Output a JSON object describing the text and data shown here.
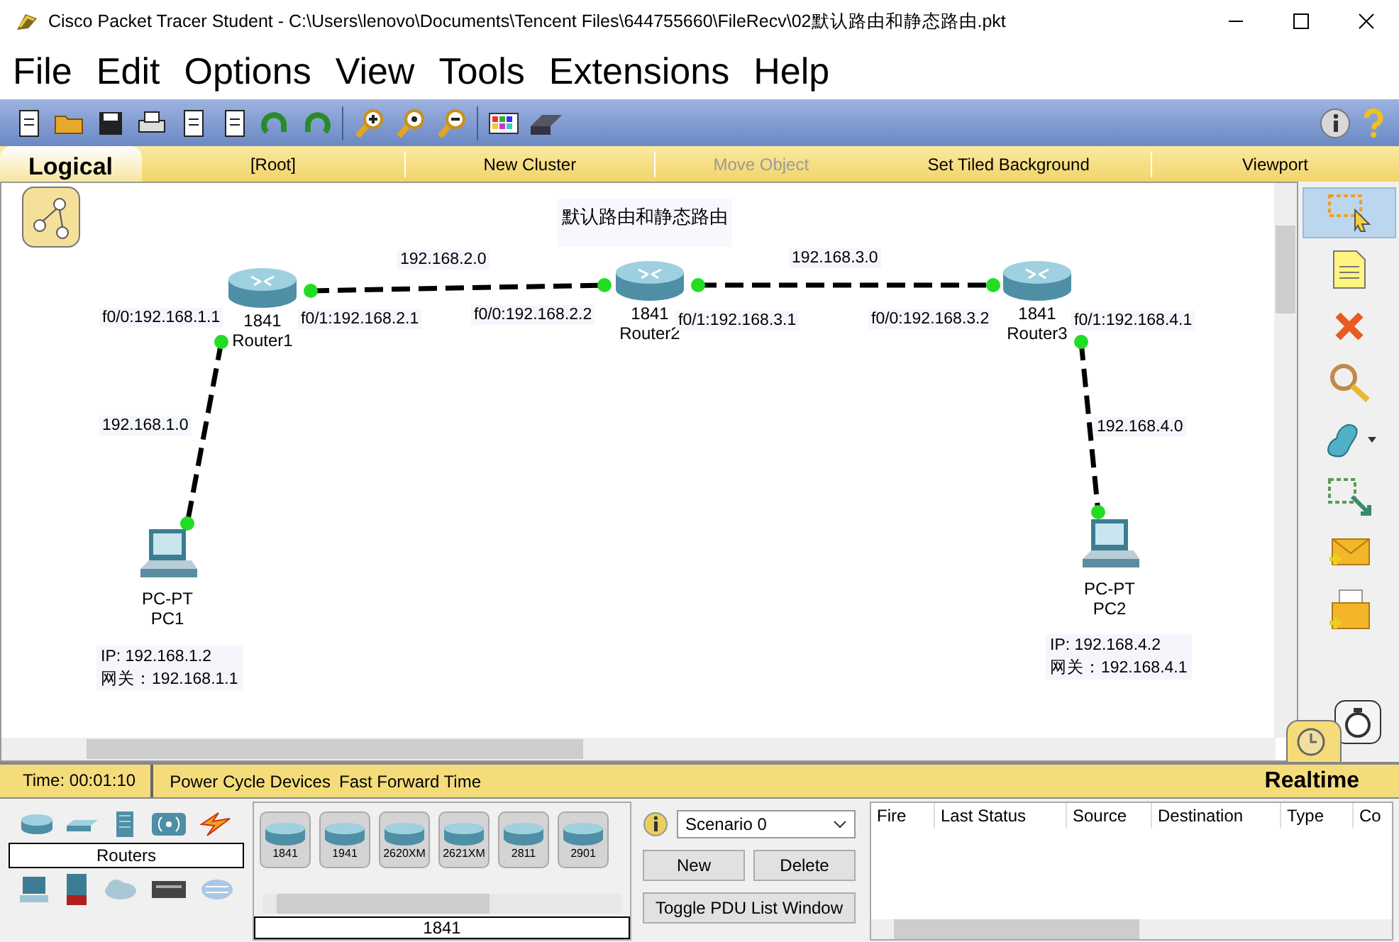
{
  "window": {
    "title": "Cisco Packet Tracer Student - C:\\Users\\lenovo\\Documents\\Tencent Files\\644755660\\FileRecv\\02默认路由和静态路由.pkt"
  },
  "menu": [
    "File",
    "Edit",
    "Options",
    "View",
    "Tools",
    "Extensions",
    "Help"
  ],
  "workspace_bar": {
    "tab": "Logical",
    "items": [
      {
        "label": "[Root]",
        "disabled": false
      },
      {
        "label": "New Cluster",
        "disabled": false
      },
      {
        "label": "Move Object",
        "disabled": true
      },
      {
        "label": "Set Tiled Background",
        "disabled": false
      },
      {
        "label": "Viewport",
        "disabled": false
      }
    ]
  },
  "canvas": {
    "note": "默认路由和静态路由",
    "devices": [
      {
        "kind": "router",
        "model": "1841",
        "name": "Router1"
      },
      {
        "kind": "router",
        "model": "1841",
        "name": "Router2"
      },
      {
        "kind": "router",
        "model": "1841",
        "name": "Router3"
      },
      {
        "kind": "pc",
        "model": "PC-PT",
        "name": "PC1",
        "ip": "IP:  192.168.1.2",
        "gateway": "网关：192.168.1.1"
      },
      {
        "kind": "pc",
        "model": "PC-PT",
        "name": "PC2",
        "ip": "IP:  192.168.4.2",
        "gateway": "网关：192.168.4.1"
      }
    ],
    "labels": [
      "192.168.2.0",
      "192.168.3.0",
      "f0/0:192.168.1.1",
      "f0/1:192.168.2.1",
      "f0/0:192.168.2.2",
      "f0/1:192.168.3.1",
      "f0/0:192.168.3.2",
      "f0/1:192.168.4.1",
      "192.168.1.0",
      "192.168.4.0"
    ]
  },
  "tools": [
    {
      "kind": "select",
      "selected": true
    },
    {
      "kind": "note",
      "selected": false
    },
    {
      "kind": "delete",
      "selected": false
    },
    {
      "kind": "inspect",
      "selected": false
    },
    {
      "kind": "shape",
      "selected": false
    },
    {
      "kind": "resize",
      "selected": false
    },
    {
      "kind": "simple-pdu",
      "selected": false
    },
    {
      "kind": "complex-pdu",
      "selected": false
    }
  ],
  "status_bar": {
    "time": "Time: 00:01:10",
    "buttons": [
      "Power Cycle Devices",
      "Fast Forward Time"
    ],
    "mode": "Realtime"
  },
  "device_panel": {
    "category": "Routers",
    "models": [
      "1841",
      "1941",
      "2620XM",
      "2621XM",
      "2811",
      "2901"
    ],
    "selected_model": "1841"
  },
  "scenario": {
    "value": "Scenario 0",
    "buttons": [
      "New",
      "Delete"
    ],
    "toggle": "Toggle PDU List Window"
  },
  "pdu_table": {
    "columns": [
      "Fire",
      "Last Status",
      "Source",
      "Destination",
      "Type",
      "Co"
    ]
  }
}
